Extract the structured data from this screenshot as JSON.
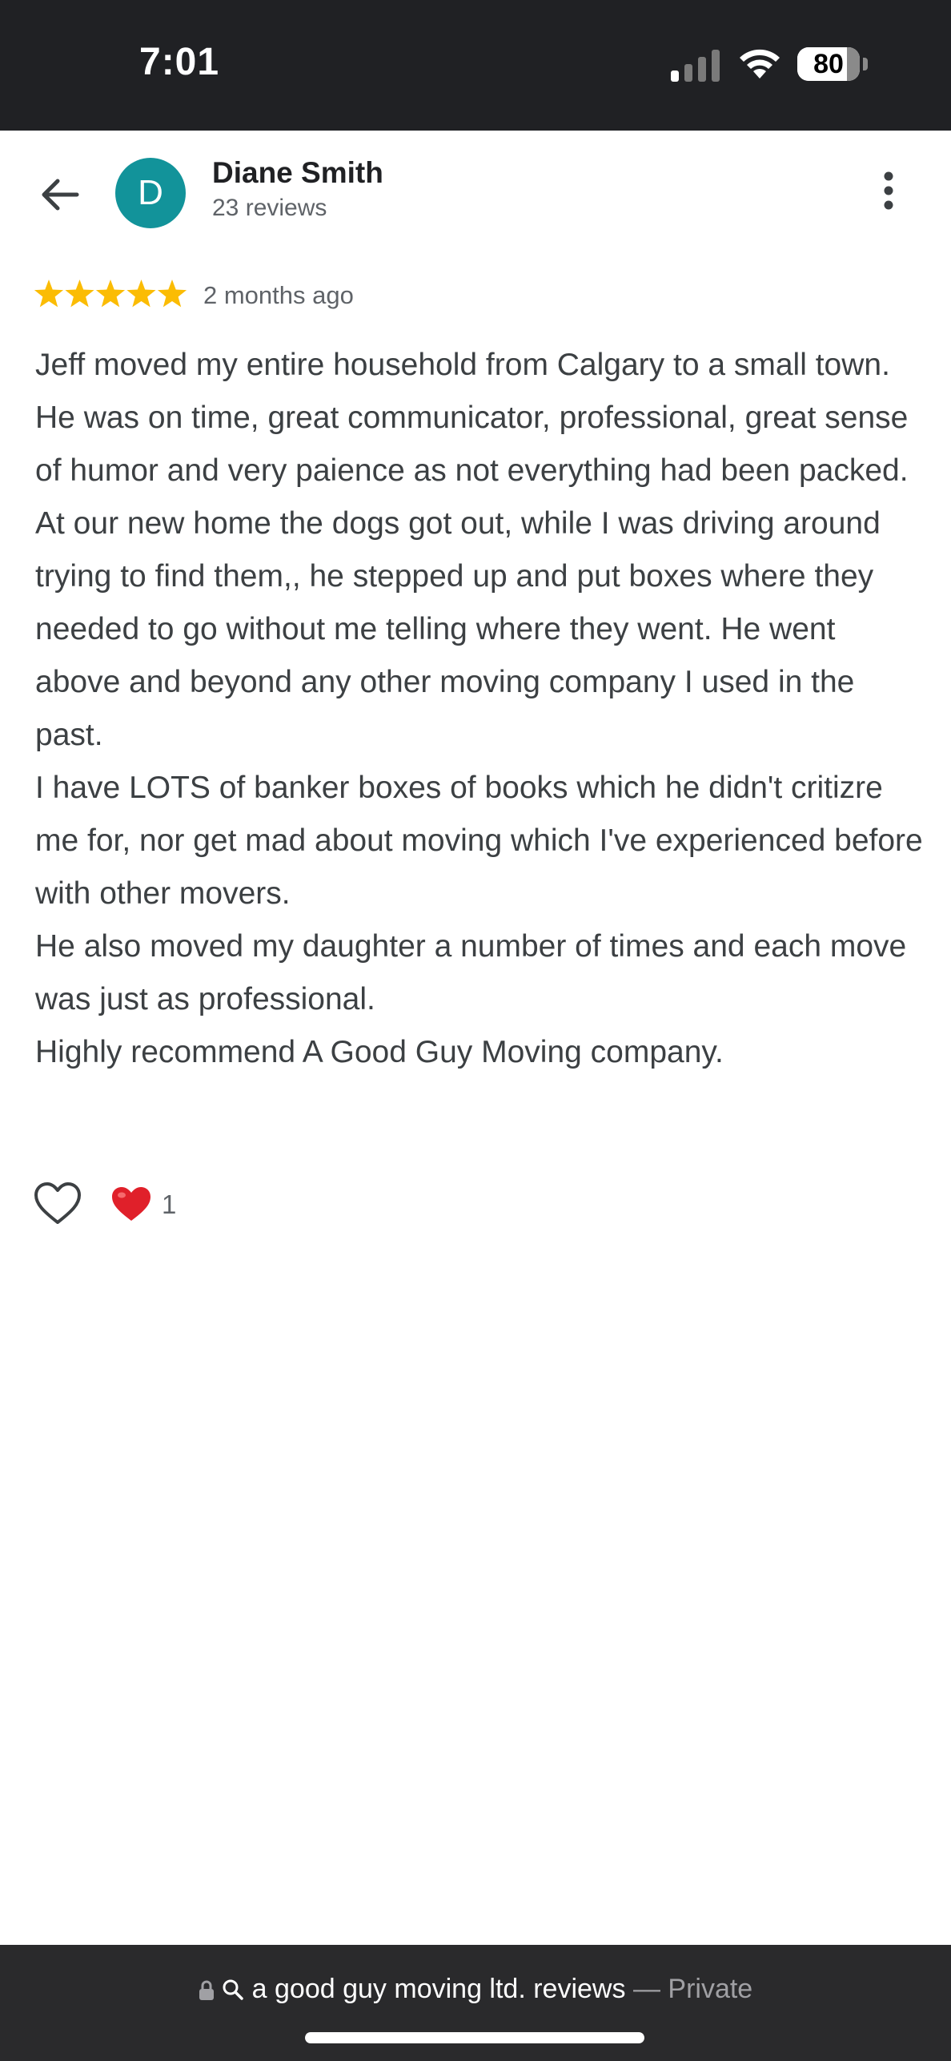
{
  "status_bar": {
    "time": "7:01",
    "battery_percent": 80,
    "battery_label": "80",
    "icons": [
      "cellular-signal-icon",
      "wifi-icon",
      "battery-icon"
    ]
  },
  "header": {
    "back_icon": "arrow-back-icon",
    "avatar_initial": "D",
    "avatar_color": "#12939a",
    "name": "Diane Smith",
    "reviews_count": "23 reviews",
    "menu_icon": "more-vert-icon"
  },
  "review": {
    "stars": 5,
    "star_color": "#fbbc04",
    "date": "2 months ago",
    "paragraphs": [
      "Jeff moved my entire household from Calgary to a small town. He was on time, great communicator, professional, great sense of humor and very paience as not everything had been packed. At our new home the dogs got out, while I was driving around trying to find them,, he stepped up and put boxes where they needed to go without me telling where they went. He went above and beyond any other moving company I used in the past.",
      "I have LOTS of banker boxes of books which he didn't critizre me for, nor get mad about moving which I've experienced before with other movers.",
      "He also moved my daughter a number of times and each move was just as professional.",
      "Highly recommend A Good Guy Moving company."
    ]
  },
  "reactions": {
    "like_icon": "heart-outline-icon",
    "reaction_icon": "red-heart-icon",
    "count": "1"
  },
  "browser_bar": {
    "lock_icon": "lock-icon",
    "search_icon": "search-icon",
    "query": "a good guy moving ltd. reviews",
    "separator": "—",
    "mode": "Private"
  }
}
